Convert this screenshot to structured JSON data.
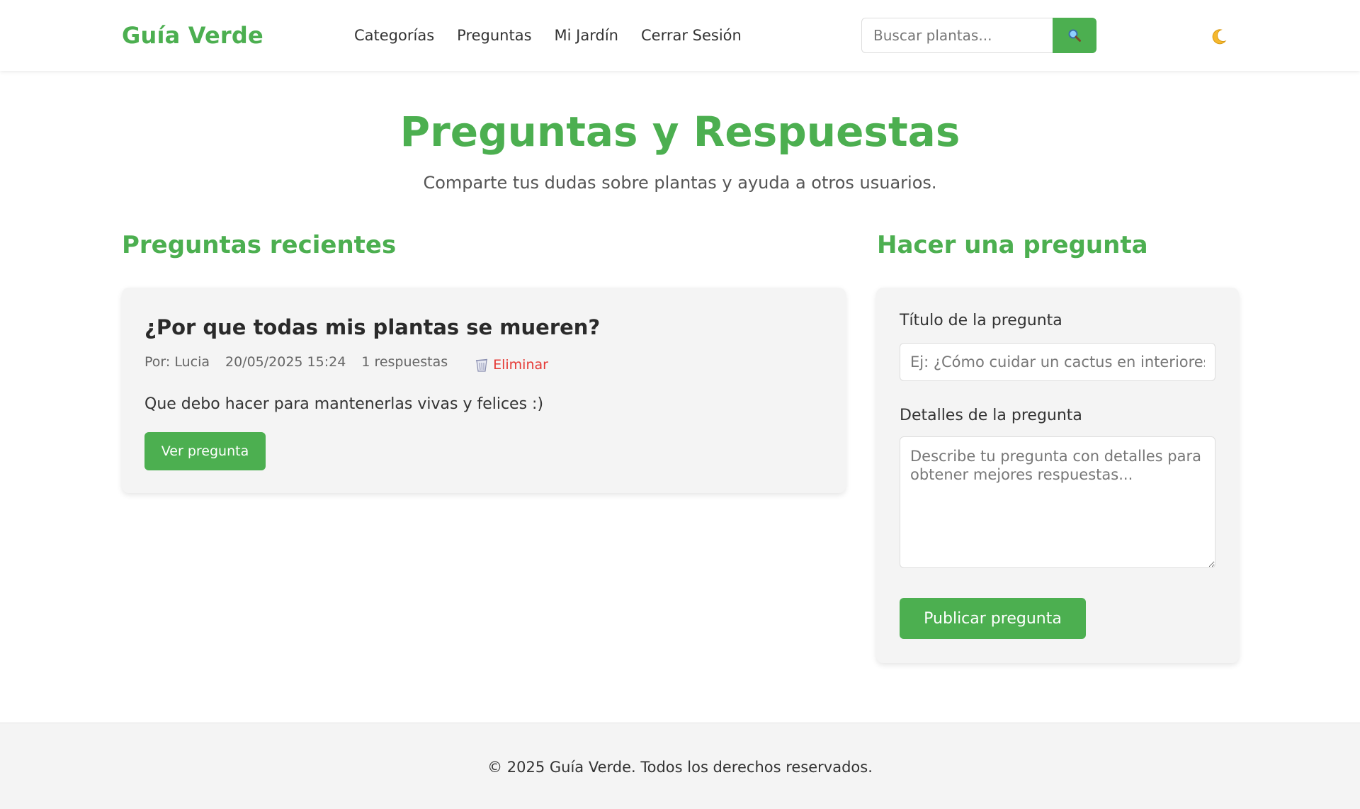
{
  "colors": {
    "brand": "#4caf50",
    "danger": "#e53935",
    "card_bg": "#f4f4f4",
    "text": "#333333"
  },
  "header": {
    "logo": "Guía Verde",
    "nav": [
      {
        "label": "Categorías",
        "icon": ""
      },
      {
        "label": "Preguntas",
        "icon": ""
      },
      {
        "label": "Mi Jardín",
        "icon": ""
      },
      {
        "label": "Cerrar Sesión",
        "icon": ""
      }
    ],
    "search": {
      "placeholder": "Buscar plantas...",
      "value": "",
      "button_icon": "magnifier-icon"
    },
    "theme_toggle_icon": "moon-icon"
  },
  "hero": {
    "title": "Preguntas y Respuestas",
    "subtitle": "Comparte tus dudas sobre plantas y ayuda a otros usuarios."
  },
  "recent": {
    "heading": "Preguntas recientes",
    "questions": [
      {
        "title": "¿Por que todas mis plantas se mueren?",
        "author": "Por: Lucia",
        "date": "20/05/2025 15:24",
        "answers": "1 respuestas",
        "delete_label": "Eliminar",
        "delete_icon": "wastebasket-icon",
        "body": "Que debo hacer para mantenerlas vivas y felices :)",
        "view_label": "Ver pregunta"
      }
    ]
  },
  "ask": {
    "heading": "Hacer una pregunta",
    "title_label": "Título de la pregunta",
    "title_placeholder": "Ej: ¿Cómo cuidar un cactus en interiores?",
    "title_value": "",
    "details_label": "Detalles de la pregunta",
    "details_placeholder": "Describe tu pregunta con detalles para obtener mejores respuestas...",
    "details_value": "",
    "submit_label": "Publicar pregunta"
  },
  "footer": {
    "text": "© 2025 Guía Verde. Todos los derechos reservados."
  }
}
